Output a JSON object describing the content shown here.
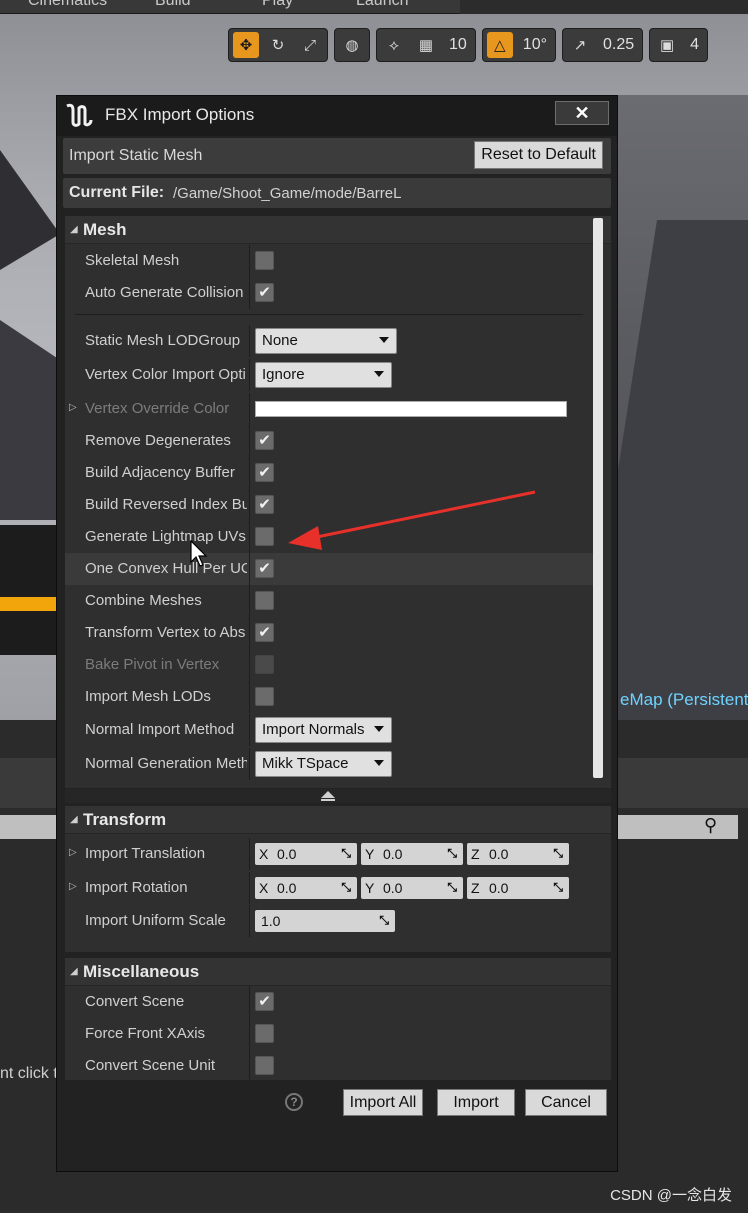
{
  "menubar": {
    "items": [
      "Cinematics",
      "Build",
      "Play",
      "Launch"
    ]
  },
  "toolbar": {
    "grid_snap": "10",
    "rotation_snap": "10°",
    "scale_snap": "0.25",
    "camera_speed": "4"
  },
  "viewport": {
    "map_label": "eMap (Persistent"
  },
  "background": {
    "side_text": "nt click t"
  },
  "watermark": "CSDN @一念白发",
  "dialog": {
    "title": "FBX Import Options",
    "close_label": "✕",
    "import_type": "Import Static Mesh",
    "reset_label": "Reset to Default",
    "current_file_label": "Current File:",
    "current_file_path": "/Game/Shoot_Game/mode/BarreL",
    "sections": {
      "mesh": {
        "title": "Mesh",
        "skeletal_mesh": "Skeletal Mesh",
        "auto_generate_collision": "Auto Generate Collision",
        "static_mesh_lodgroup": "Static Mesh LODGroup",
        "static_mesh_lodgroup_value": "None",
        "vertex_color_import": "Vertex Color Import Opti",
        "vertex_color_import_value": "Ignore",
        "vertex_override_color": "Vertex Override Color",
        "remove_degenerates": "Remove Degenerates",
        "build_adjacency_buffer": "Build Adjacency Buffer",
        "build_reversed_index": "Build Reversed Index Bu",
        "generate_lightmap_uvs": "Generate Lightmap UVs",
        "one_convex_hull": "One Convex Hull Per UC:",
        "combine_meshes": "Combine Meshes",
        "transform_vertex": "Transform Vertex to Abs",
        "bake_pivot": "Bake Pivot in Vertex",
        "import_mesh_lods": "Import Mesh LODs",
        "normal_import_method": "Normal Import Method",
        "normal_import_method_value": "Import Normals",
        "normal_generation_method": "Normal Generation Meth",
        "normal_generation_method_value": "Mikk TSpace"
      },
      "transform": {
        "title": "Transform",
        "import_translation": "Import Translation",
        "import_rotation": "Import Rotation",
        "import_uniform_scale": "Import Uniform Scale",
        "uniform_scale_value": "1.0",
        "axis_x": "X",
        "axis_y": "Y",
        "axis_z": "Z",
        "translation": {
          "x": "0.0",
          "y": "0.0",
          "z": "0.0"
        },
        "rotation": {
          "x": "0.0",
          "y": "0.0",
          "z": "0.0"
        }
      },
      "misc": {
        "title": "Miscellaneous",
        "convert_scene": "Convert Scene",
        "force_front_xaxis": "Force Front XAxis",
        "convert_scene_unit": "Convert Scene Unit"
      }
    },
    "buttons": {
      "import_all": "Import All",
      "import": "Import",
      "cancel": "Cancel"
    }
  },
  "state": {
    "skeletal_mesh": false,
    "auto_generate_collision": true,
    "remove_degenerates": true,
    "build_adjacency_buffer": true,
    "build_reversed_index": true,
    "generate_lightmap_uvs": false,
    "one_convex_hull": true,
    "combine_meshes": false,
    "transform_vertex": true,
    "bake_pivot": false,
    "import_mesh_lods": false,
    "convert_scene": true,
    "force_front_xaxis": false,
    "convert_scene_unit": false
  },
  "colors": {
    "annotation_arrow": "#e8302a",
    "toolbar_active": "#e7961e",
    "map_label": "#6fd3ff"
  }
}
